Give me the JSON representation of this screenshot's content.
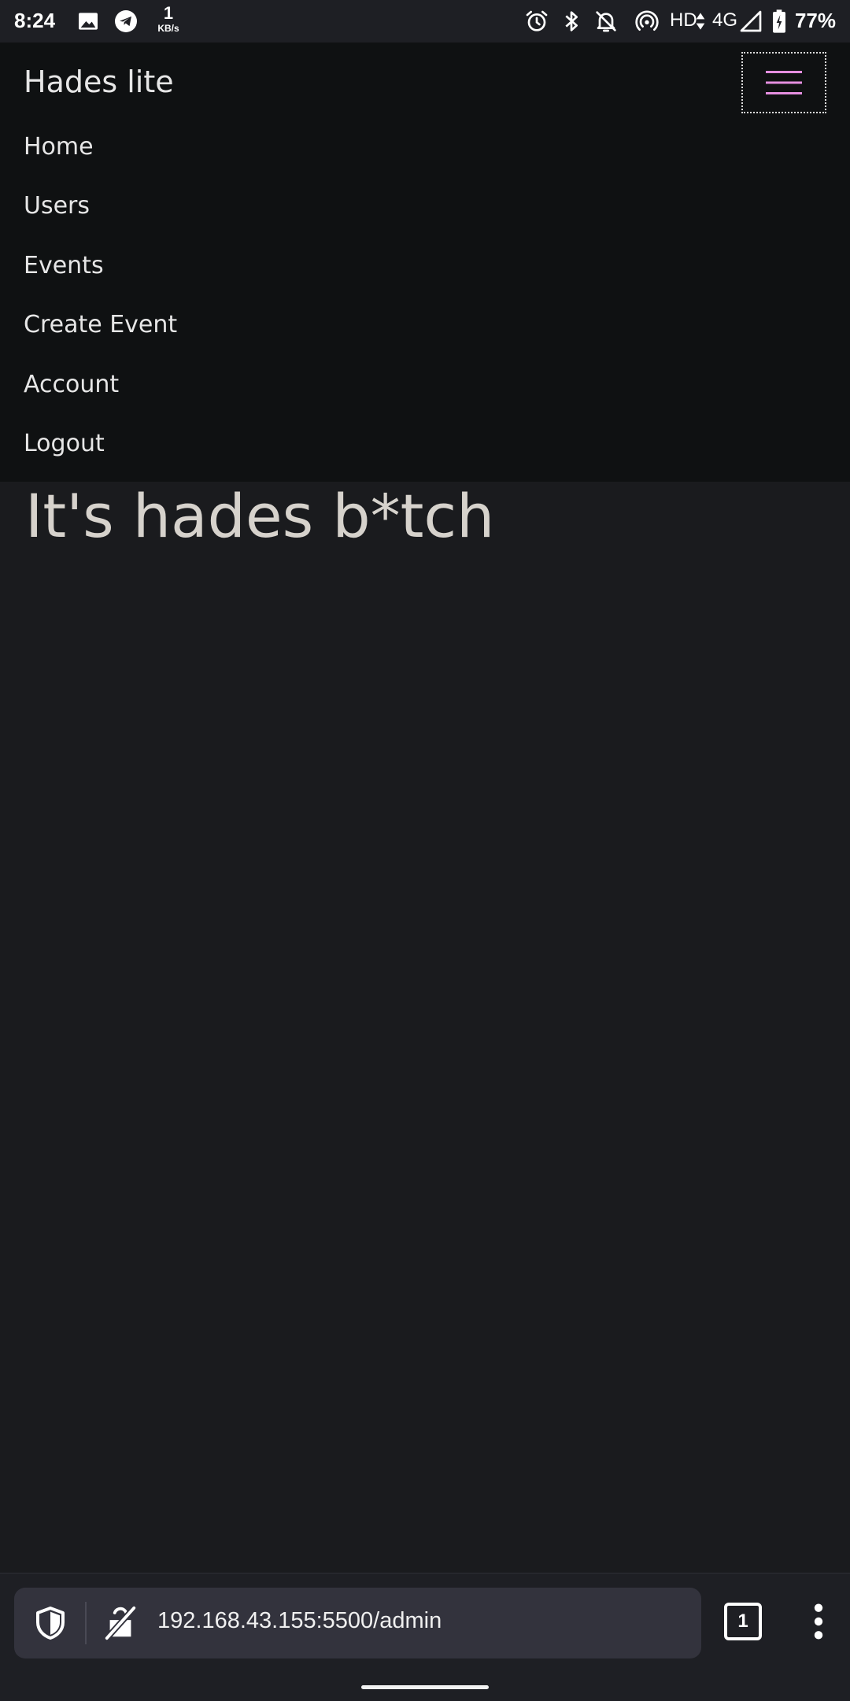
{
  "status_bar": {
    "time": "8:24",
    "net_speed_value": "1",
    "net_speed_unit": "KB/s",
    "network_label": "HD",
    "network_type": "4G",
    "battery_percent": "77%",
    "icons": [
      "gallery-icon",
      "telegram-icon",
      "alarm-icon",
      "bluetooth-icon",
      "notifications-off-icon",
      "hotspot-icon",
      "data-arrows-icon",
      "signal-icon",
      "battery-charging-icon"
    ]
  },
  "navbar": {
    "brand": "Hades lite",
    "toggler_icon": "hamburger-icon",
    "toggler_color": "#e58fe0",
    "items": [
      {
        "label": "Home"
      },
      {
        "label": "Users"
      },
      {
        "label": "Events"
      },
      {
        "label": "Create Event"
      },
      {
        "label": "Account"
      },
      {
        "label": "Logout"
      }
    ]
  },
  "main": {
    "title": "It's hades b*tch"
  },
  "browser": {
    "url": "192.168.43.155:5500/admin",
    "tab_count": "1",
    "icons": [
      "shield-icon",
      "not-secure-lock-icon",
      "tabs-icon",
      "more-vert-icon"
    ]
  }
}
